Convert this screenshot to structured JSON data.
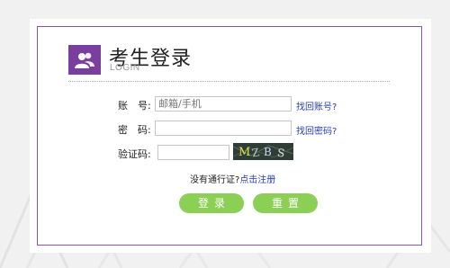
{
  "header": {
    "title": "考生登录",
    "subtitle": "LOGIN",
    "logo_icon": "users-icon"
  },
  "form": {
    "account_label": "账　号:",
    "account_placeholder": "邮箱/手机",
    "account_value": "",
    "find_account_link": "找回账号?",
    "password_label": "密　码:",
    "password_value": "",
    "find_password_link": "找回密码?",
    "captcha_label": "验证码:",
    "captcha_value": "",
    "captcha_text": "M Z B S",
    "register_prompt": "没有通行证?",
    "register_link": "点击注册",
    "login_button": "登录",
    "reset_button": "重置"
  },
  "colors": {
    "brand_purple": "#7a3f9e",
    "button_green": "#8bcf55",
    "link_blue": "#2a3fb5"
  }
}
